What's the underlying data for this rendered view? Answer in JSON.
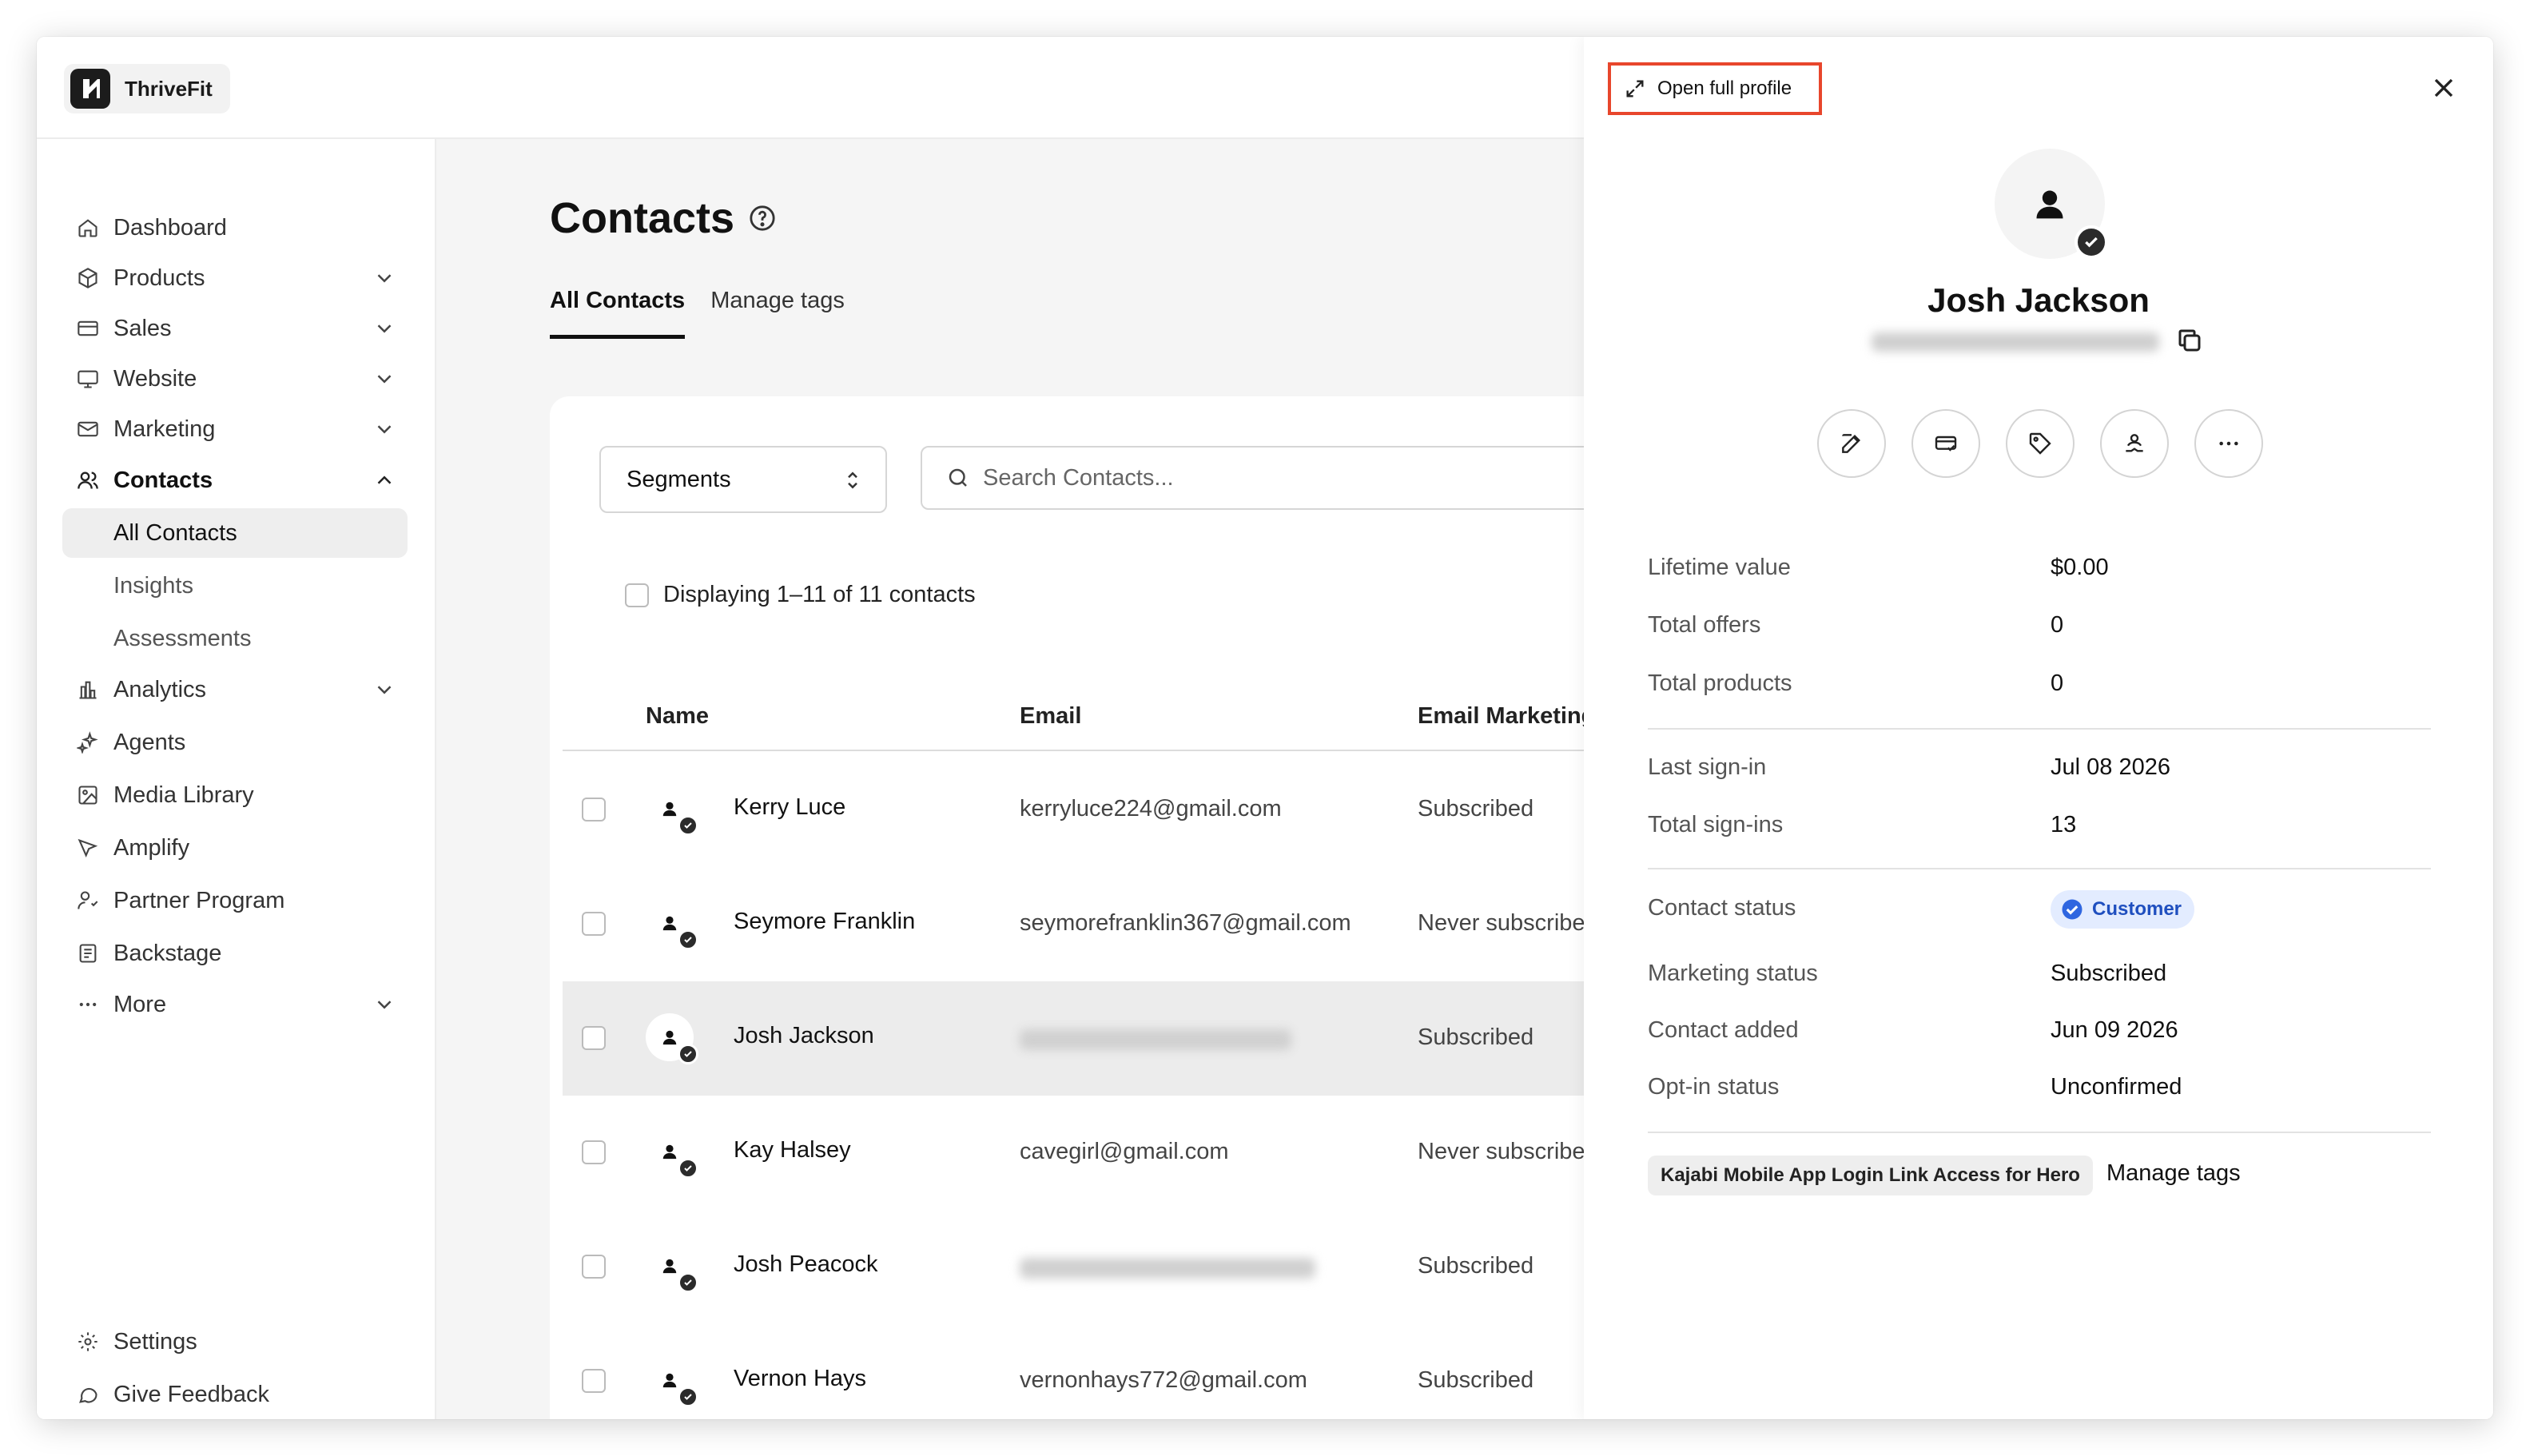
{
  "brand": {
    "name": "ThriveFit"
  },
  "sidebar": {
    "items": [
      {
        "label": "Dashboard",
        "icon": "home-icon"
      },
      {
        "label": "Products",
        "icon": "box-icon"
      },
      {
        "label": "Sales",
        "icon": "card-icon"
      },
      {
        "label": "Website",
        "icon": "monitor-icon"
      },
      {
        "label": "Marketing",
        "icon": "mail-icon"
      },
      {
        "label": "Contacts",
        "icon": "users-icon"
      },
      {
        "label": "All Contacts"
      },
      {
        "label": "Insights"
      },
      {
        "label": "Assessments"
      },
      {
        "label": "Analytics",
        "icon": "bar-chart-icon"
      },
      {
        "label": "Agents",
        "icon": "sparkle-icon"
      },
      {
        "label": "Media Library",
        "icon": "image-icon"
      },
      {
        "label": "Amplify",
        "icon": "megaphone-icon"
      },
      {
        "label": "Partner Program",
        "icon": "partner-icon"
      },
      {
        "label": "Backstage",
        "icon": "backstage-icon"
      },
      {
        "label": "More",
        "icon": "dots-icon"
      }
    ],
    "footer": [
      {
        "label": "Settings",
        "icon": "gear-icon"
      },
      {
        "label": "Give Feedback",
        "icon": "chat-icon"
      }
    ]
  },
  "main": {
    "title": "Contacts",
    "tabs": [
      "All Contacts",
      "Manage tags"
    ],
    "segments_label": "Segments",
    "search_placeholder": "Search Contacts...",
    "display_text": "Displaying 1–11 of 11 contacts",
    "columns": [
      "Name",
      "Email",
      "Email Marketing"
    ],
    "rows": [
      {
        "name": "Kerry Luce",
        "email": "kerryluce224@gmail.com",
        "marketing": "Subscribed",
        "email_blurred": false
      },
      {
        "name": "Seymore Franklin",
        "email": "seymorefranklin367@gmail.com",
        "marketing": "Never subscribe",
        "email_blurred": false
      },
      {
        "name": "Josh Jackson",
        "email": "",
        "marketing": "Subscribed",
        "email_blurred": true
      },
      {
        "name": "Kay Halsey",
        "email": "cavegirl@gmail.com",
        "marketing": "Never subscribe",
        "email_blurred": false
      },
      {
        "name": "Josh Peacock",
        "email": "",
        "marketing": "Subscribed",
        "email_blurred": true
      },
      {
        "name": "Vernon Hays",
        "email": "vernonhays772@gmail.com",
        "marketing": "Subscribed",
        "email_blurred": false
      }
    ]
  },
  "drawer": {
    "open_full_profile": "Open full profile",
    "name": "Josh Jackson",
    "stats": [
      {
        "label": "Lifetime value",
        "value": "$0.00"
      },
      {
        "label": "Total offers",
        "value": "0"
      },
      {
        "label": "Total products",
        "value": "0"
      }
    ],
    "signins": [
      {
        "label": "Last sign-in",
        "value": "Jul 08 2026"
      },
      {
        "label": "Total sign-ins",
        "value": "13"
      }
    ],
    "status": {
      "contact_status_label": "Contact status",
      "contact_status_value": "Customer",
      "marketing_status_label": "Marketing status",
      "marketing_status_value": "Subscribed",
      "contact_added_label": "Contact added",
      "contact_added_value": "Jun 09 2026",
      "optin_label": "Opt-in status",
      "optin_value": "Unconfirmed"
    },
    "tag": "Kajabi Mobile App Login Link Access for Hero",
    "manage_tags": "Manage tags",
    "colors": {
      "highlight_border": "#e8462c",
      "customer_pill_bg": "#e3ecff",
      "customer_pill_text": "#1f4fbf"
    }
  }
}
